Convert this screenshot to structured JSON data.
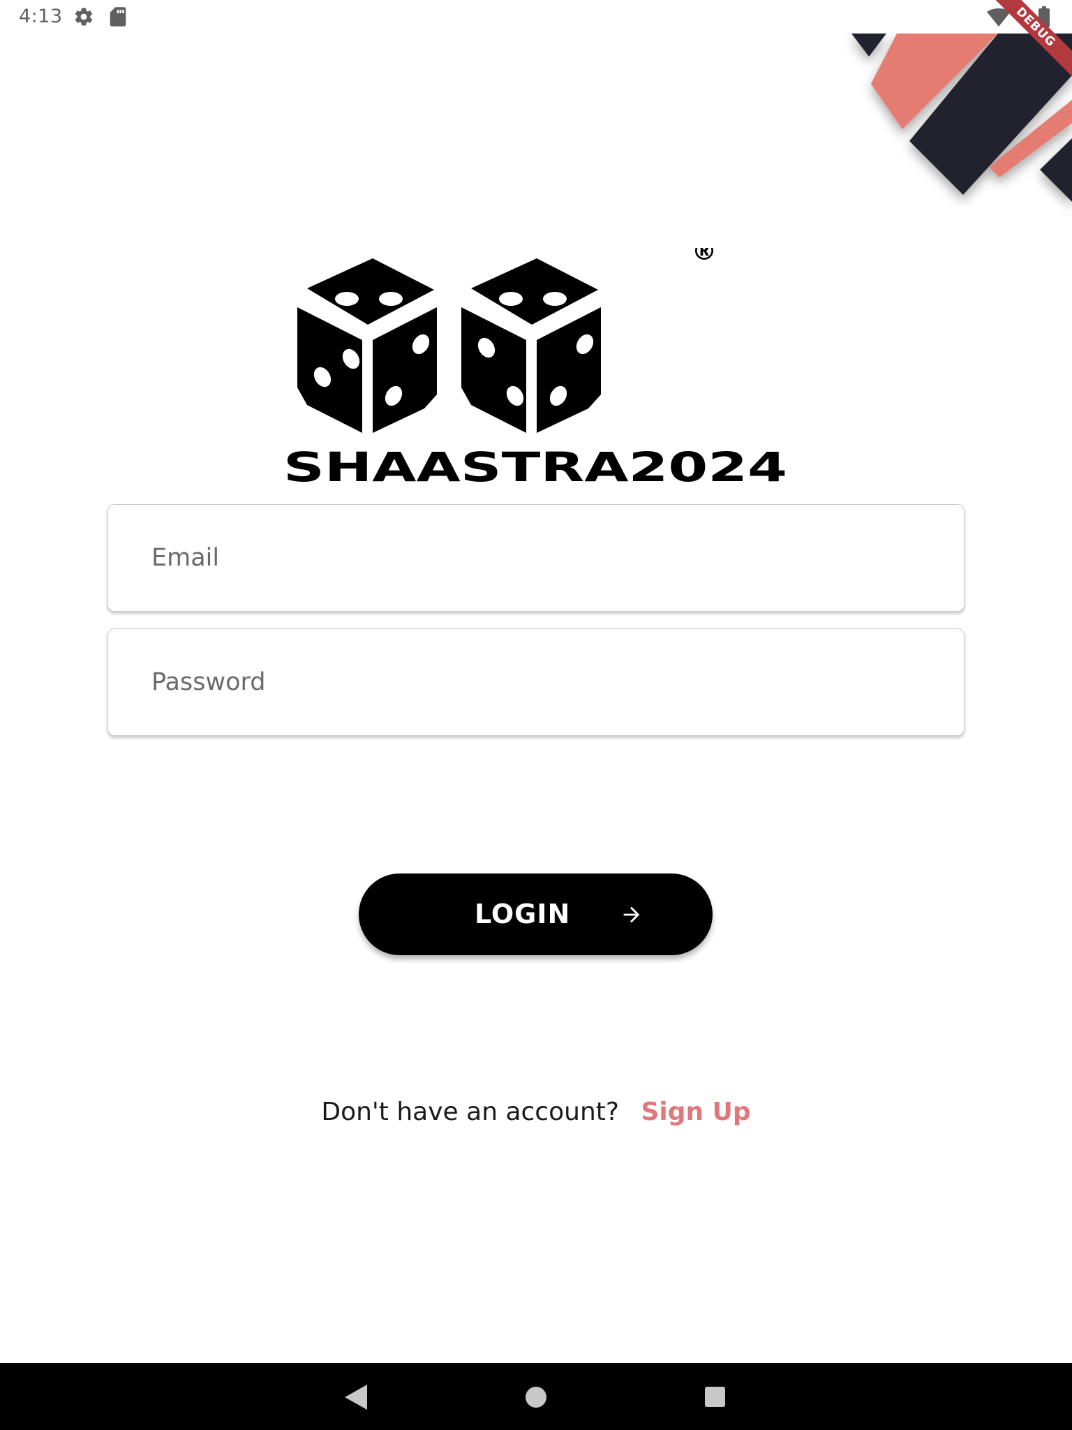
{
  "status_bar": {
    "time": "4:13",
    "icons": [
      "gear-icon",
      "sd-card-icon",
      "wifi-icon",
      "battery-icon"
    ]
  },
  "debug_banner": {
    "label": "DEBUG",
    "color": "#b23a3f"
  },
  "logo": {
    "text": "SHAASTRA2024",
    "registered_mark": "®",
    "icon": "dice-icon"
  },
  "form": {
    "email": {
      "placeholder": "Email",
      "value": ""
    },
    "password": {
      "placeholder": "Password",
      "value": ""
    }
  },
  "login_button": {
    "label": "LOGIN",
    "icon": "arrow-right-icon"
  },
  "signup": {
    "prompt": "Don't have an account?",
    "link": "Sign Up"
  },
  "nav_bar": {
    "icons": [
      "back-icon",
      "home-icon",
      "recents-icon"
    ]
  },
  "colors": {
    "accent": "#e0777b",
    "stripe_dark": "#22222e",
    "stripe_coral": "#e57b71",
    "button": "#000000"
  }
}
